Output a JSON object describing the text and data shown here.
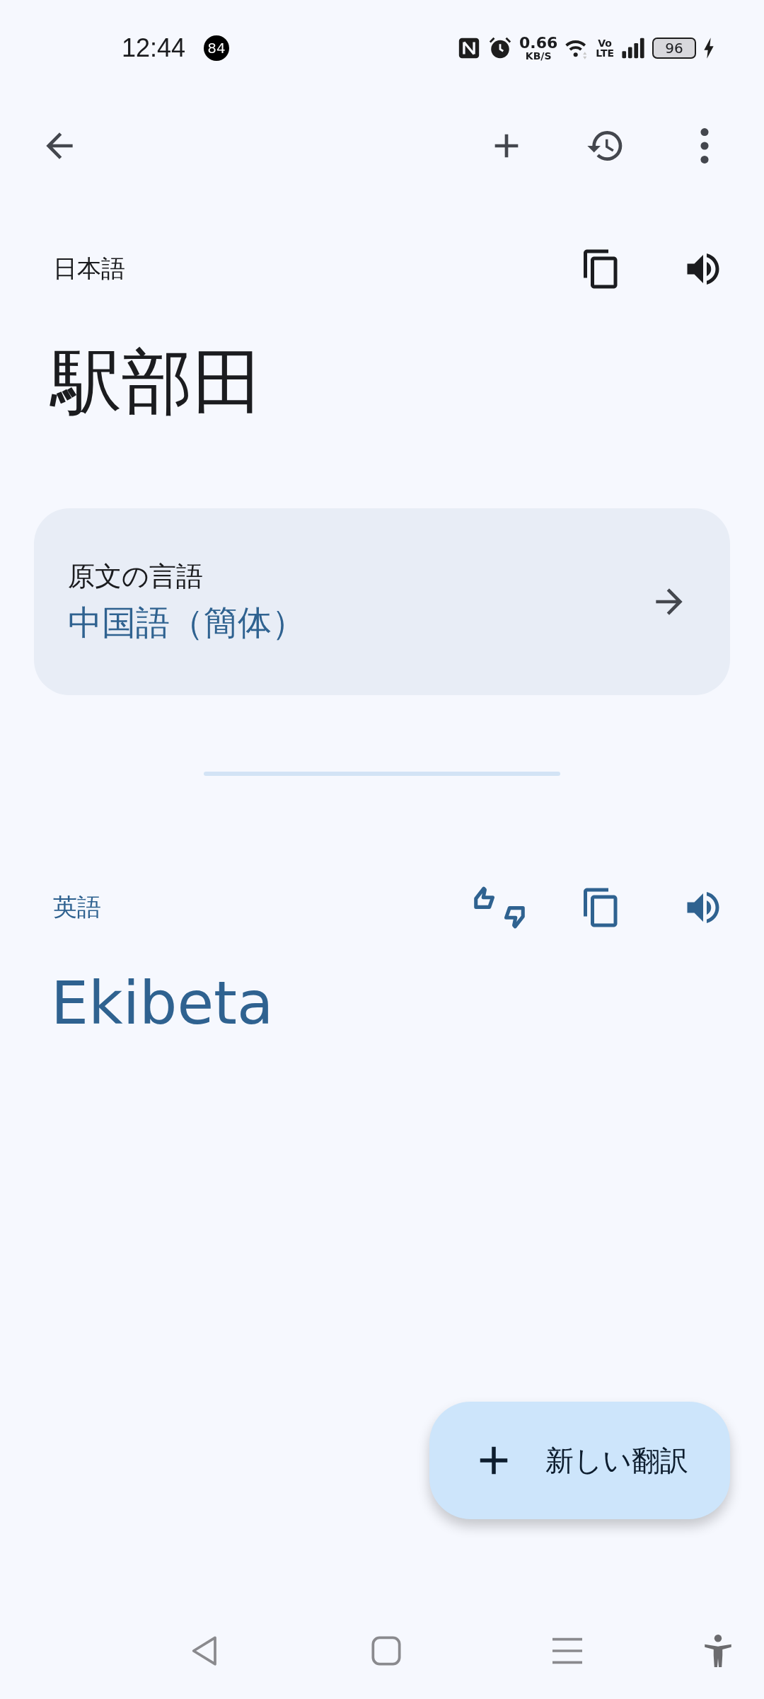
{
  "status_bar": {
    "time": "12:44",
    "notification_count": "84",
    "speed": "0.66",
    "speed_unit": "KB/S",
    "network_top": "Vo",
    "network_bottom": "LTE",
    "battery": "96"
  },
  "source": {
    "language": "日本語",
    "text": "駅部田"
  },
  "detected": {
    "label": "原文の言語",
    "language": "中国語（簡体）"
  },
  "target": {
    "language": "英語",
    "text": "Ekibeta"
  },
  "fab": {
    "label": "新しい翻訳"
  }
}
